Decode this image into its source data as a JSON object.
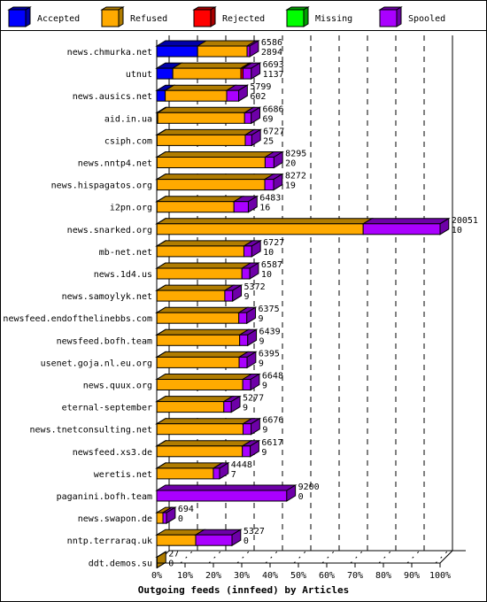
{
  "chart_data": {
    "type": "bar",
    "orientation": "horizontal",
    "stacked": true,
    "three_d": true,
    "title": "Outgoing feeds (innfeed) by Articles",
    "xlabel": "Outgoing feeds (innfeed) by Articles",
    "ylabel": "",
    "x_tick_labels": [
      "0%",
      "10%",
      "20%",
      "30%",
      "40%",
      "50%",
      "60%",
      "70%",
      "80%",
      "90%",
      "100%"
    ],
    "xlim": [
      0,
      20051
    ],
    "grid": true,
    "legend_position": "top",
    "legend": [
      {
        "name": "Accepted",
        "color": "#0000ff",
        "shade": "#0000a8"
      },
      {
        "name": "Refused",
        "color": "#ffaa00",
        "shade": "#b07c00"
      },
      {
        "name": "Rejected",
        "color": "#ff0000",
        "shade": "#a80000"
      },
      {
        "name": "Missing",
        "color": "#00ff00",
        "shade": "#00a000"
      },
      {
        "name": "Spooled",
        "color": "#aa00ff",
        "shade": "#6e00a8"
      }
    ],
    "categories": [
      "news.chmurka.net",
      "utnut",
      "news.ausics.net",
      "aid.in.ua",
      "csiph.com",
      "news.nntp4.net",
      "news.hispagatos.org",
      "i2pn.org",
      "news.snarked.org",
      "mb-net.net",
      "news.1d4.us",
      "news.samoylyk.net",
      "newsfeed.endofthelinebbs.com",
      "newsfeed.bofh.team",
      "usenet.goja.nl.eu.org",
      "news.quux.org",
      "eternal-september",
      "news.tnetconsulting.net",
      "newsfeed.xs3.de",
      "weretis.net",
      "paganini.bofh.team",
      "news.swapon.de",
      "nntp.terraraq.uk",
      "ddt.demos.su"
    ],
    "offered": [
      6586,
      6693,
      5799,
      6686,
      6727,
      8295,
      8272,
      6483,
      20051,
      6727,
      6587,
      5372,
      6375,
      6439,
      6395,
      6648,
      5277,
      6676,
      6617,
      4448,
      9200,
      694,
      5327,
      27
    ],
    "accepted_label": [
      2894,
      1137,
      602,
      69,
      25,
      20,
      19,
      16,
      10,
      10,
      10,
      9,
      9,
      9,
      9,
      9,
      9,
      9,
      9,
      7,
      0,
      0,
      0,
      0
    ],
    "series": [
      {
        "name": "Accepted",
        "values": [
          2894,
          1137,
          602,
          69,
          25,
          20,
          19,
          16,
          10,
          10,
          10,
          9,
          9,
          9,
          9,
          9,
          9,
          9,
          9,
          7,
          0,
          0,
          0,
          0
        ]
      },
      {
        "name": "Refused",
        "values": [
          3500,
          4820,
          4350,
          6150,
          6240,
          7650,
          7630,
          5450,
          14600,
          6160,
          6020,
          4810,
          5800,
          5860,
          5820,
          6080,
          4740,
          6100,
          6050,
          4000,
          0,
          440,
          2757,
          27
        ]
      },
      {
        "name": "Rejected",
        "values": [
          0,
          150,
          0,
          0,
          0,
          0,
          0,
          0,
          0,
          0,
          0,
          0,
          0,
          0,
          0,
          0,
          0,
          0,
          0,
          0,
          0,
          0,
          0,
          0
        ]
      },
      {
        "name": "Missing",
        "values": [
          0,
          0,
          0,
          0,
          0,
          0,
          0,
          0,
          0,
          0,
          0,
          0,
          0,
          0,
          0,
          0,
          0,
          0,
          0,
          0,
          0,
          0,
          0,
          0
        ]
      },
      {
        "name": "Spooled",
        "values": [
          192,
          586,
          847,
          467,
          462,
          625,
          623,
          1017,
          5441,
          557,
          557,
          553,
          566,
          570,
          566,
          559,
          528,
          567,
          558,
          441,
          9200,
          254,
          2570,
          0
        ]
      }
    ]
  }
}
